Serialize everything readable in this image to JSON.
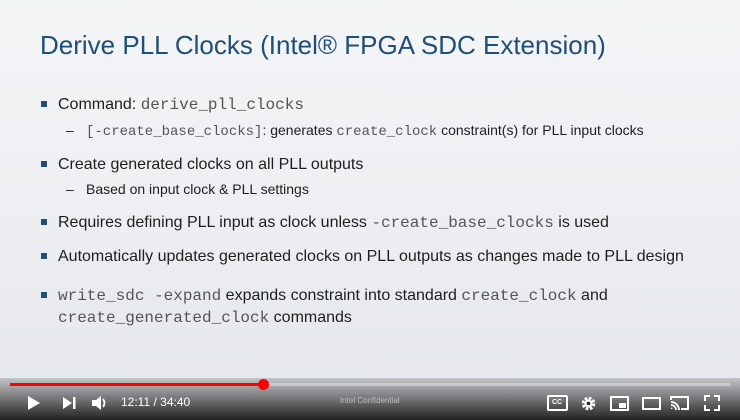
{
  "slide": {
    "title": "Derive PLL Clocks (Intel® FPGA SDC Extension)",
    "bullets": [
      {
        "parts": [
          "Command:  ",
          "derive_pll_clocks"
        ]
      },
      {
        "parts": [
          "[-create_base_clocks]",
          ": generates ",
          "create_clock",
          " constraint(s) for PLL input clocks"
        ]
      },
      {
        "parts": [
          "Create generated clocks on all PLL outputs"
        ]
      },
      {
        "parts": [
          "Based on input clock & PLL settings"
        ]
      },
      {
        "parts": [
          "Requires defining PLL input as clock unless ",
          "-create_base_clocks",
          " is used"
        ]
      },
      {
        "parts": [
          "Automatically updates generated clocks on PLL outputs as changes made to PLL design"
        ]
      },
      {
        "parts": [
          "write_sdc -expand",
          " expands constraint into standard ",
          "create_clock",
          " and ",
          "create_generated_clock",
          " commands"
        ]
      }
    ]
  },
  "player": {
    "time_display": "12:11 / 34:40",
    "progress_fraction": 0.351,
    "watermark": "Intel Confidential",
    "cc_label": "CC",
    "icons": {
      "play": "play-icon",
      "next": "next-icon",
      "volume": "volume-icon",
      "captions": "captions-icon",
      "settings": "gear-icon",
      "miniplayer": "miniplayer-icon",
      "theater": "theater-icon",
      "cast": "cast-icon",
      "fullscreen": "fullscreen-icon"
    }
  }
}
